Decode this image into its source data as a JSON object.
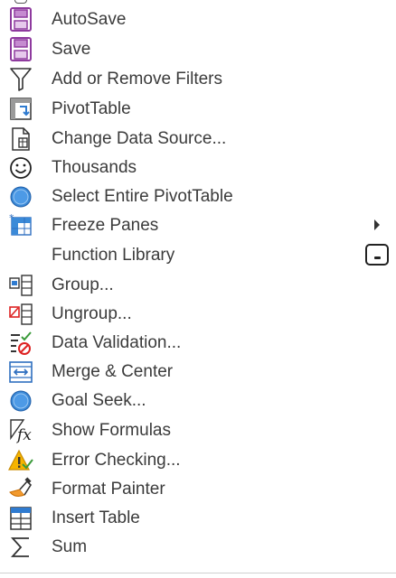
{
  "menu": {
    "items": [
      {
        "label": "AutoSave",
        "icon": "autosave-icon"
      },
      {
        "label": "Save",
        "icon": "save-icon"
      },
      {
        "label": "Add or Remove Filters",
        "icon": "filter-icon"
      },
      {
        "label": "PivotTable",
        "icon": "pivottable-icon"
      },
      {
        "label": "Change Data Source...",
        "icon": "change-data-source-icon"
      },
      {
        "label": "Thousands",
        "icon": "smiley-icon"
      },
      {
        "label": "Select Entire PivotTable",
        "icon": "blue-circle-icon"
      },
      {
        "label": "Freeze Panes",
        "icon": "freeze-panes-icon",
        "submenu": true
      },
      {
        "label": "Function Library",
        "icon": "",
        "dropdown": true
      },
      {
        "label": "Group...",
        "icon": "group-icon"
      },
      {
        "label": "Ungroup...",
        "icon": "ungroup-icon"
      },
      {
        "label": "Data Validation...",
        "icon": "data-validation-icon"
      },
      {
        "label": "Merge & Center",
        "icon": "merge-center-icon"
      },
      {
        "label": "Goal Seek...",
        "icon": "blue-circle-icon"
      },
      {
        "label": "Show Formulas",
        "icon": "show-formulas-icon"
      },
      {
        "label": "Error Checking...",
        "icon": "error-checking-icon"
      },
      {
        "label": "Format Painter",
        "icon": "format-painter-icon"
      },
      {
        "label": "Insert Table",
        "icon": "insert-table-icon"
      },
      {
        "label": "Sum",
        "icon": "sum-icon"
      }
    ]
  },
  "colors": {
    "save_purple": "#8e3a9e",
    "circle_blue": "#3b8ad8",
    "label_text": "#3b3b3b"
  }
}
